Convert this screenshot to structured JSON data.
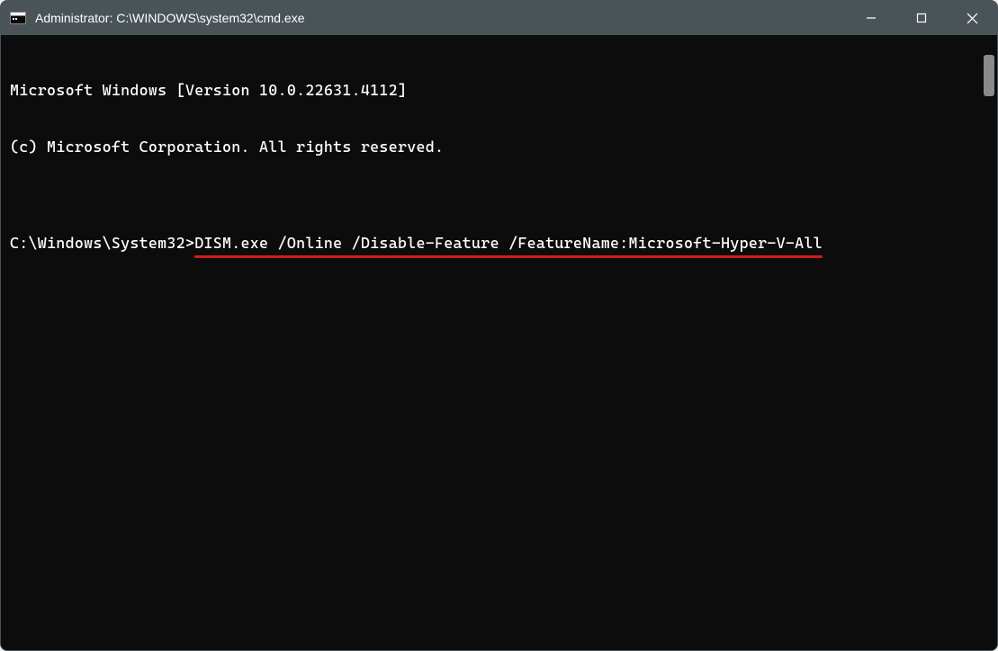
{
  "titlebar": {
    "title": "Administrator: C:\\WINDOWS\\system32\\cmd.exe"
  },
  "terminal": {
    "line1": "Microsoft Windows [Version 10.0.22631.4112]",
    "line2": "(c) Microsoft Corporation. All rights reserved.",
    "blank": "",
    "prompt": "C:\\Windows\\System32>",
    "command": "DISM.exe /Online /Disable-Feature /FeatureName:Microsoft-Hyper-V-All"
  },
  "annotation": {
    "color": "#d41a1a"
  }
}
